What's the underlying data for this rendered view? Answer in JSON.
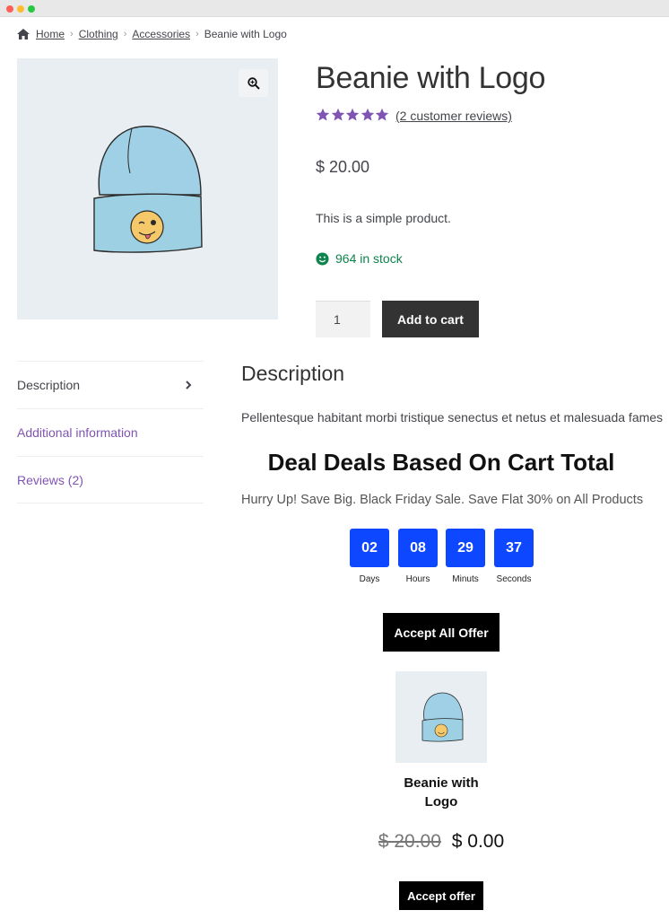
{
  "breadcrumb": {
    "home": "Home",
    "clothing": "Clothing",
    "accessories": "Accessories",
    "current": "Beanie with Logo"
  },
  "product": {
    "title": "Beanie with Logo",
    "rating": 5,
    "reviews_link": "(2 customer reviews)",
    "price": "$ 20.00",
    "short_description": "This is a simple product.",
    "stock": "964 in stock",
    "quantity": "1",
    "add_to_cart": "Add to cart"
  },
  "tabs": [
    {
      "label": "Description"
    },
    {
      "label": "Additional information"
    },
    {
      "label": "Reviews (2)"
    }
  ],
  "description": {
    "heading": "Description",
    "text": "Pellentesque habitant morbi tristique senectus et netus et malesuada fames"
  },
  "deal": {
    "title": "Deal Deals Based On Cart Total",
    "subtitle": "Hurry Up! Save Big. Black Friday Sale. Save Flat 30% on All Products",
    "timer": [
      {
        "value": "02",
        "label": "Days"
      },
      {
        "value": "08",
        "label": "Hours"
      },
      {
        "value": "29",
        "label": "Minuts"
      },
      {
        "value": "37",
        "label": "Seconds"
      }
    ],
    "accept_all": "Accept All Offer",
    "offer": {
      "name": "Beanie with Logo",
      "old_price": "$ 20.00",
      "new_price": "$ 0.00",
      "accept": "Accept offer"
    }
  },
  "colors": {
    "accent_purple": "#7f54b3",
    "stock_green": "#0f834d",
    "timer_blue": "#0d47ff",
    "button_dark": "#333333"
  },
  "icons": [
    "home-icon",
    "zoom-icon",
    "star-icon",
    "smiley-icon",
    "chevron-right-icon"
  ]
}
